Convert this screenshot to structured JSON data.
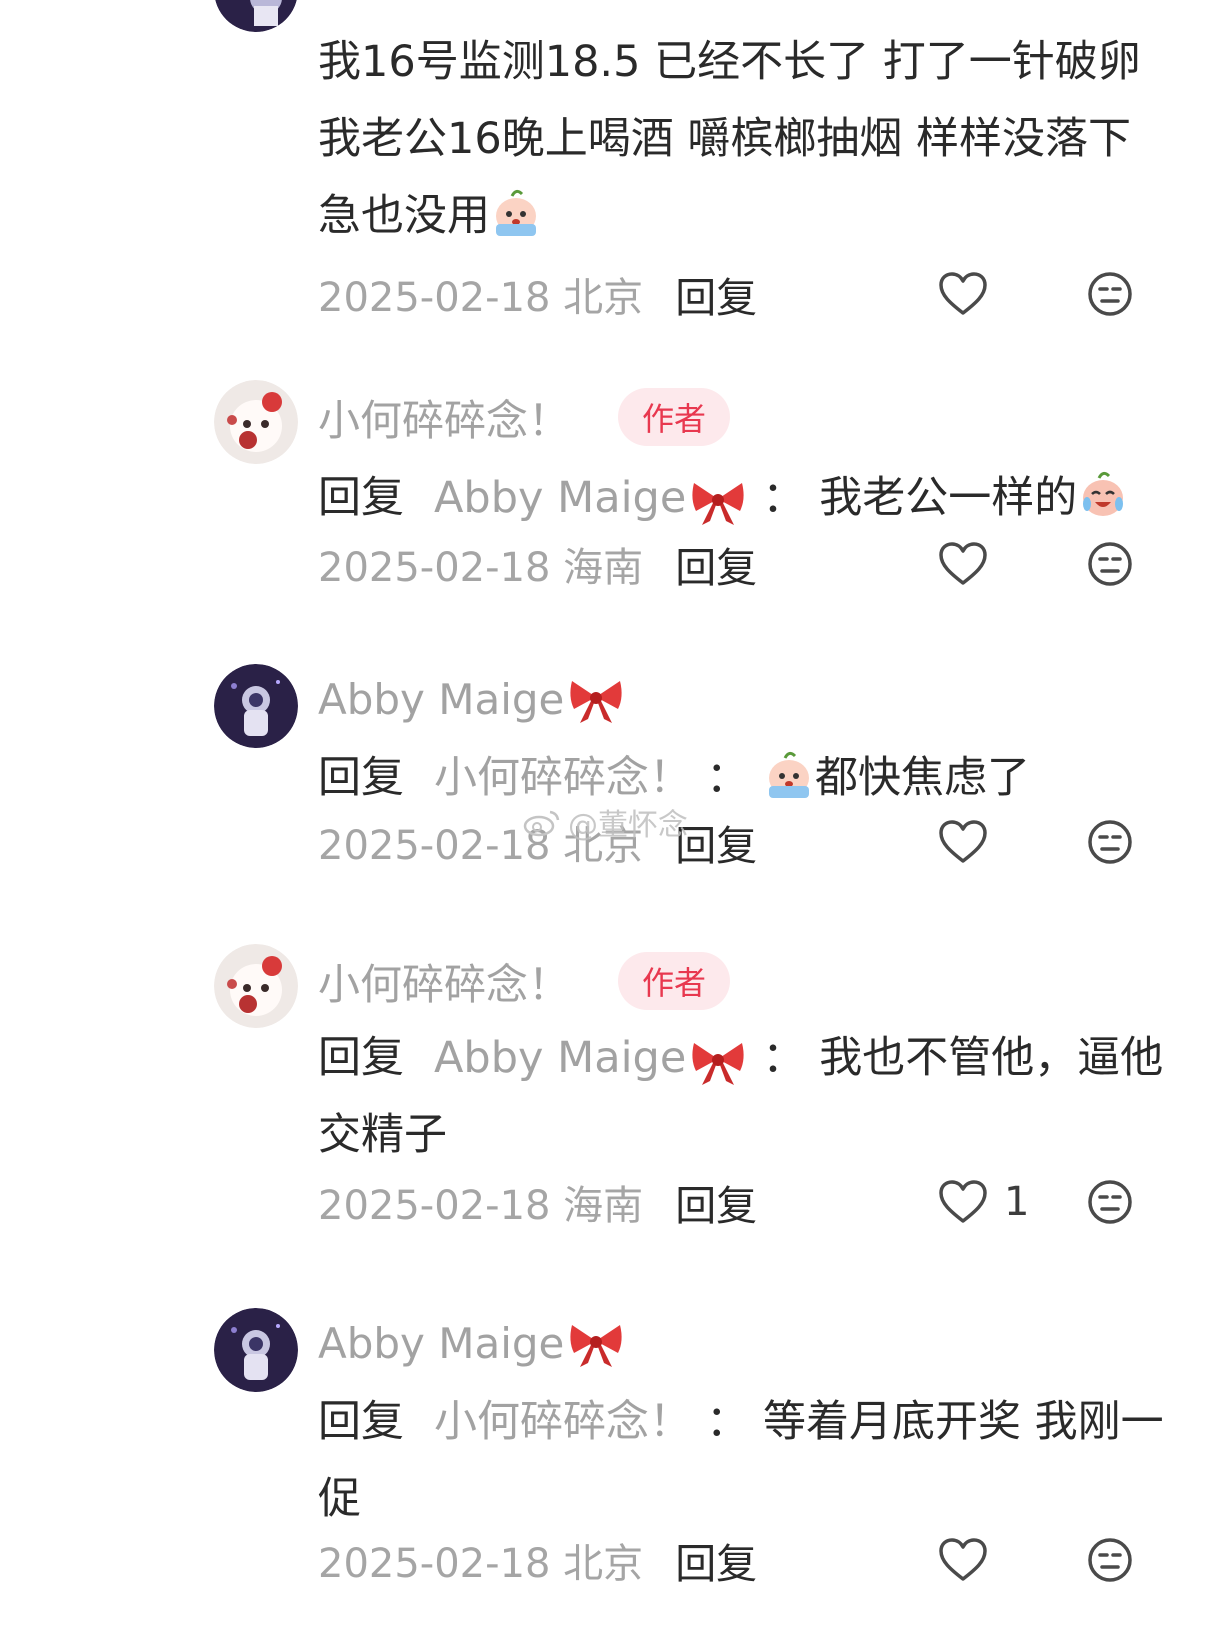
{
  "comments": [
    {
      "text": "我16号监测18.5  已经不长了 打了一针破卵  我老公16晚上喝酒  嚼槟榔抽烟 样样没落下  急也没用",
      "emoji": "crying-face-emoji",
      "date": "2025-02-18 北京",
      "reply_label": "回复",
      "like_count": ""
    },
    {
      "username": "小何碎碎念！",
      "badge": "作者",
      "reply_kw": "回复",
      "reply_target": "Abby Maige",
      "colon": "：",
      "text": "我老公一样的",
      "emoji": "laughing-crying-emoji",
      "date": "2025-02-18 海南",
      "reply_label": "回复",
      "like_count": ""
    },
    {
      "username": "Abby Maige",
      "reply_kw": "回复",
      "reply_target": "小何碎碎念！",
      "colon": "：",
      "text": "都快焦虑了",
      "emoji": "crying-face-emoji",
      "date": "2025-02-18 北京",
      "reply_label": "回复",
      "like_count": ""
    },
    {
      "username": "小何碎碎念！",
      "badge": "作者",
      "reply_kw": "回复",
      "reply_target": "Abby Maige",
      "colon": "：",
      "text": "我也不管他，逼他交精子",
      "date": "2025-02-18 海南",
      "reply_label": "回复",
      "like_count": "1"
    },
    {
      "username": "Abby Maige",
      "reply_kw": "回复",
      "reply_target": "小何碎碎念！",
      "colon": "：",
      "text": "等着月底开奖  我刚一促",
      "date": "2025-02-18 北京",
      "reply_label": "回复",
      "like_count": ""
    }
  ],
  "watermark": "@董怀念",
  "colors": {
    "author_badge_bg": "#fde9ec",
    "author_badge_text": "#e8384f",
    "username": "#a2a2a2",
    "body_text": "#2a2a2a",
    "meta_text": "#a5a5a5"
  },
  "icons": [
    "heart-outline-icon",
    "neutral-face-icon",
    "red-bow-icon",
    "weibo-logo-icon"
  ]
}
